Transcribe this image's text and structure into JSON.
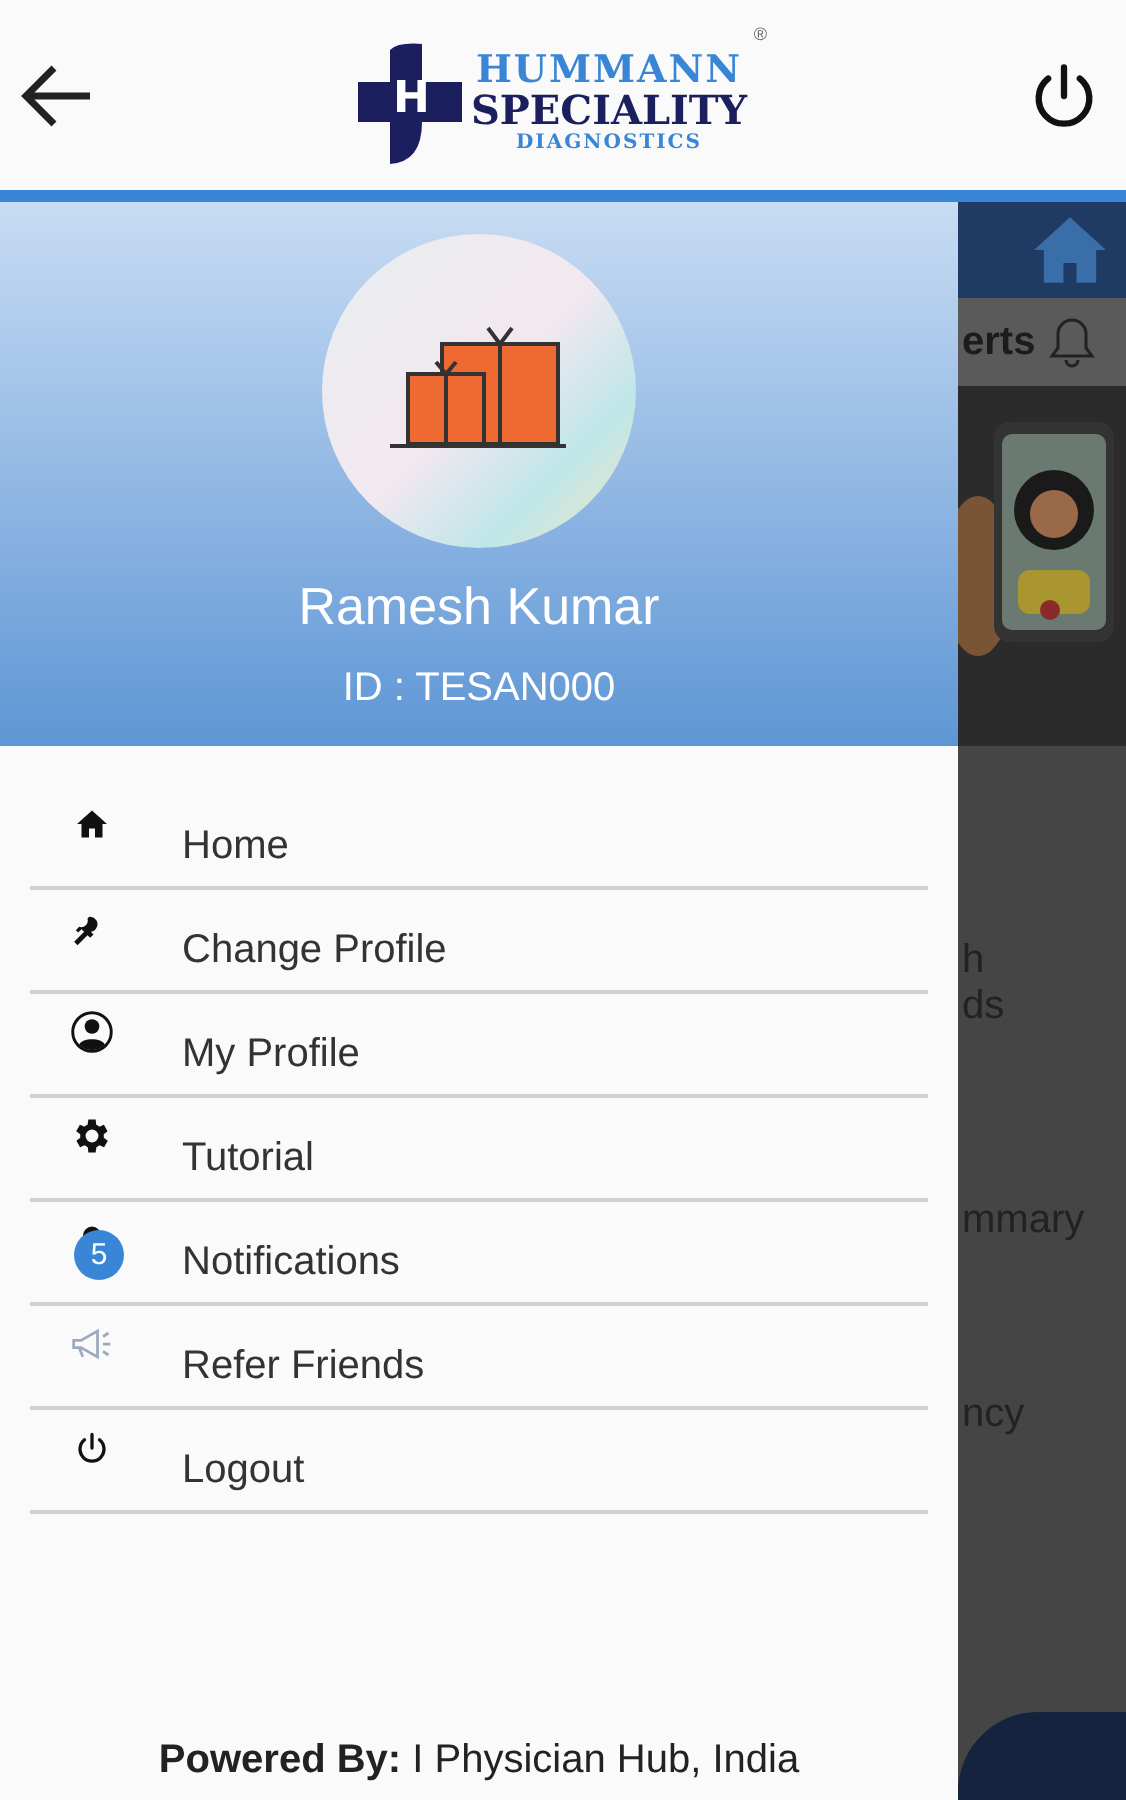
{
  "header": {
    "logo": {
      "mark": "H",
      "line1": "HUMMANN",
      "line2": "SPECIALITY",
      "line3": "DIAGNOSTICS",
      "registered": "®"
    }
  },
  "drawer": {
    "profile": {
      "name": "Ramesh Kumar",
      "id": "ID : TESAN000"
    },
    "items": [
      {
        "label": "Home"
      },
      {
        "label": "Change Profile"
      },
      {
        "label": "My Profile"
      },
      {
        "label": "Tutorial"
      },
      {
        "label": "Notifications",
        "badge": "5"
      },
      {
        "label": "Refer Friends"
      },
      {
        "label": "Logout"
      }
    ],
    "footer": "**Powered By:** I Physician Hub, India"
  },
  "background": {
    "tab": "erts",
    "fragments": [
      "h",
      "ds",
      "mmary",
      "ncy"
    ]
  }
}
